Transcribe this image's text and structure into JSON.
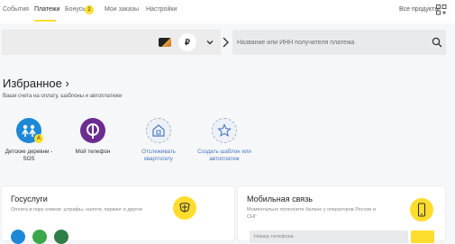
{
  "nav": {
    "tabs": [
      {
        "label": "События"
      },
      {
        "label": "Платежи"
      },
      {
        "label": "Бонусы"
      },
      {
        "label": "Мои заказы"
      },
      {
        "label": "Настройки"
      }
    ],
    "bonus_count": "2",
    "all_products": "Все продукты"
  },
  "payment": {
    "currency_symbol": "₽",
    "search_placeholder": "Название или ИНН получателя платежа"
  },
  "favorites": {
    "title": "Избранное ›",
    "subtitle": "Ваши счета на оплату, шаблоны и автоплатежи",
    "items": [
      {
        "label": "Детские деревни - SOS",
        "badge": "A"
      },
      {
        "label": "Мой телефон"
      },
      {
        "label": "Отслеживать квартплату"
      },
      {
        "label": "Создать шаблон или автоплатеж"
      }
    ]
  },
  "gosuslugi": {
    "title": "Госуслуги",
    "description": "Оплата в пару кликов: штрафы, налоги, паркинг и другое"
  },
  "mobile": {
    "title": "Мобильная связь",
    "description": "Моментально пополните баланс у операторов России и СНГ",
    "phone_placeholder": "Номер телефона"
  },
  "colors": {
    "accent": "#ffdd2d",
    "link": "#4a78c2",
    "phone_purple": "#6b2d8f",
    "sos_blue": "#1e88d8"
  }
}
